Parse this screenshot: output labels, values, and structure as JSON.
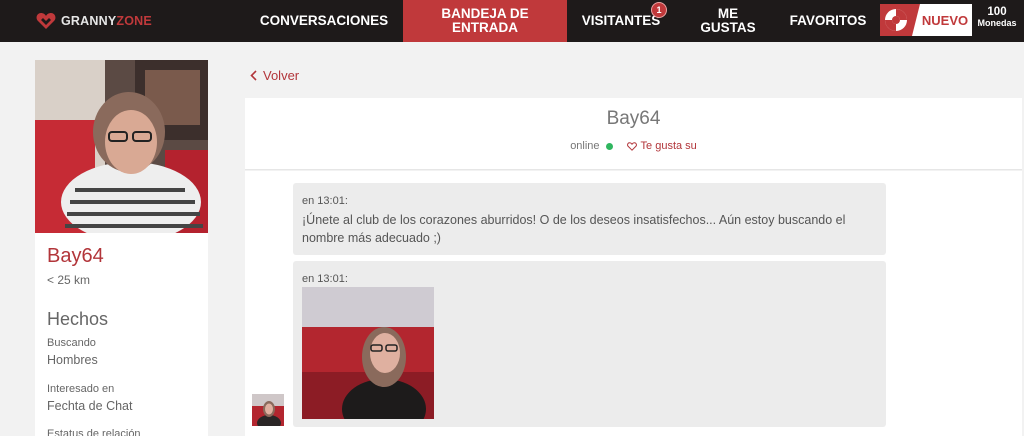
{
  "brand": {
    "part1": "GRANNY",
    "part2": "ZONE"
  },
  "nav": {
    "conversations": "CONVERSACIONES",
    "inbox": "BANDEJA DE ENTRADA",
    "visitors": "VISITANTES",
    "visitors_badge": "1",
    "likes": "ME GUSTAS",
    "favorites": "FAVORITOS"
  },
  "promo": {
    "label": "NUEVO"
  },
  "coins": {
    "amount": "100",
    "label": "Monedas"
  },
  "profile": {
    "name": "Bay64",
    "distance": "< 25 km",
    "facts_title": "Hechos",
    "facts": [
      {
        "label": "Buscando",
        "value": "Hombres"
      },
      {
        "label": "Interesado en",
        "value": "Fechta de Chat"
      },
      {
        "label": "Estatus de relación",
        "value": ""
      }
    ]
  },
  "back_link": "Volver",
  "chat": {
    "name": "Bay64",
    "status": "online",
    "like_label": "Te gusta su",
    "messages": [
      {
        "time": "en 13:01:",
        "text": "¡Únete al club de los corazones aburridos! O de los deseos insatisfechos... Aún estoy buscando el nombre más adecuado ;)"
      },
      {
        "time": "en 13:01:",
        "text": ""
      }
    ]
  },
  "colors": {
    "accent": "#c0393b",
    "nav_bg": "#1e1a1a",
    "online": "#2fb65f"
  },
  "icons": [
    "heart-logo-icon",
    "chevron-left-icon",
    "heart-outline-icon",
    "lifebuoy-icon"
  ]
}
